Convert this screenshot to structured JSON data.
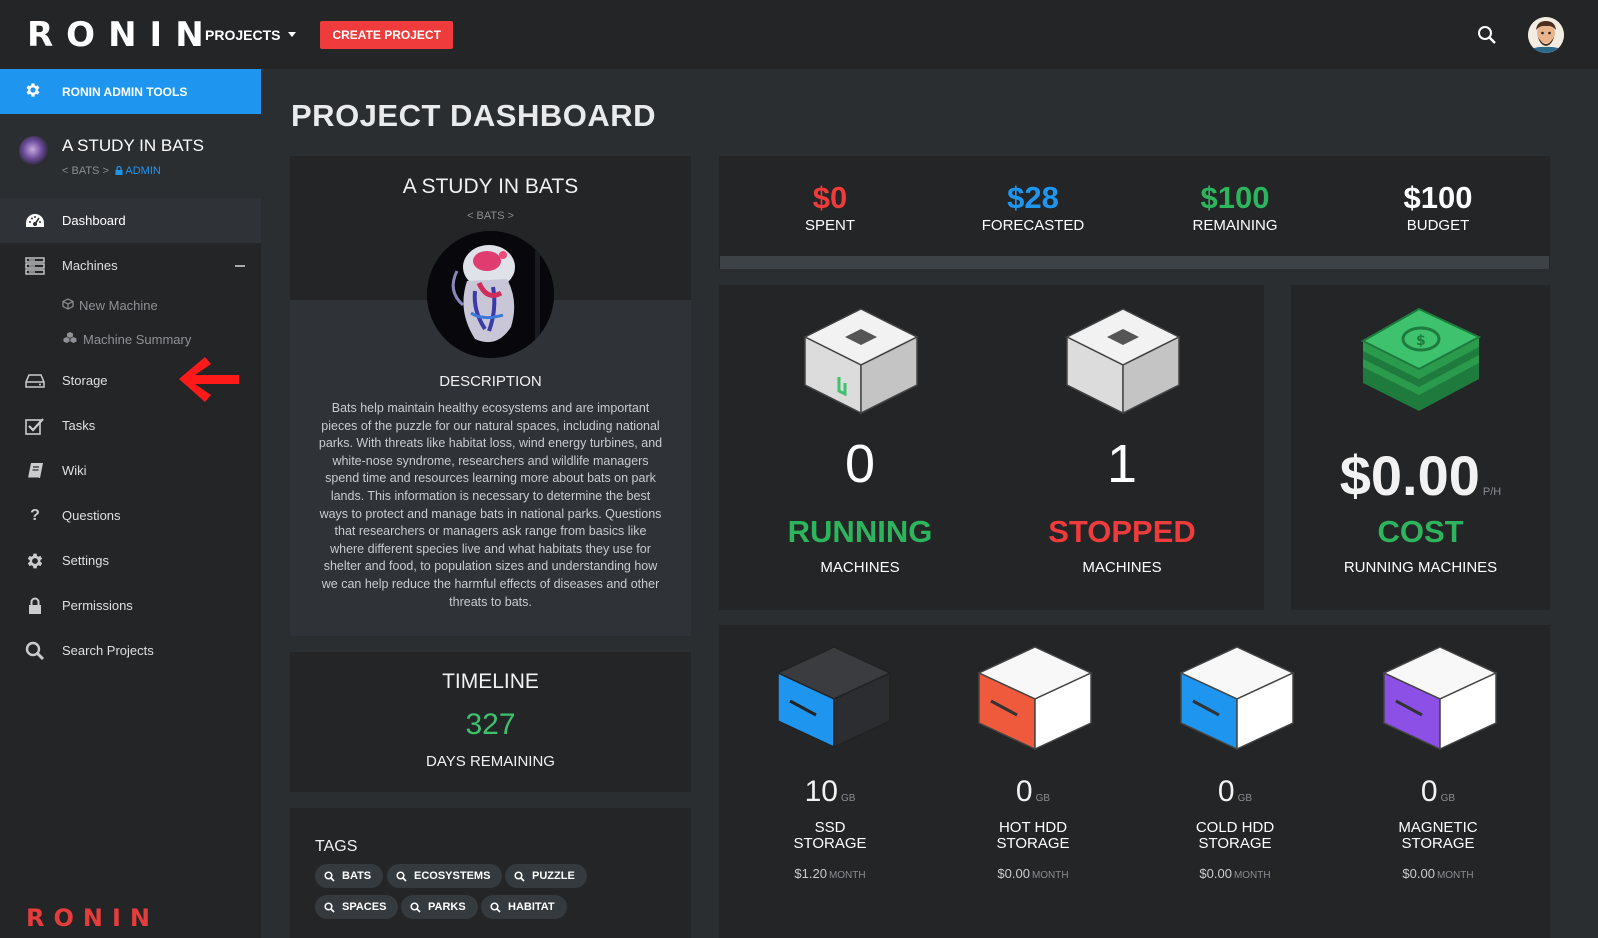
{
  "topbar": {
    "logo": "RONIN",
    "projects_label": "PROJECTS",
    "create_label": "CREATE PROJECT"
  },
  "sidebar": {
    "admin_tools": "RONIN ADMIN TOOLS",
    "project_title": "A STUDY IN BATS",
    "project_slug": "< BATS >",
    "project_role": "ADMIN",
    "items": [
      {
        "label": "Dashboard",
        "icon": "dashboard-icon"
      },
      {
        "label": "Machines",
        "icon": "server-icon"
      },
      {
        "label": "Storage",
        "icon": "hard-drive-icon"
      },
      {
        "label": "Tasks",
        "icon": "checkbox-icon"
      },
      {
        "label": "Wiki",
        "icon": "book-icon"
      },
      {
        "label": "Questions",
        "icon": "question-icon"
      },
      {
        "label": "Settings",
        "icon": "gear-icon"
      },
      {
        "label": "Permissions",
        "icon": "lock-icon"
      },
      {
        "label": "Search Projects",
        "icon": "search-icon"
      }
    ],
    "sub_items": [
      {
        "label": "New Machine",
        "icon": "cube-icon"
      },
      {
        "label": "Machine Summary",
        "icon": "cubes-icon"
      }
    ],
    "footer_logo": "RONIN"
  },
  "main": {
    "page_title": "PROJECT DASHBOARD",
    "project": {
      "title": "A STUDY IN BATS",
      "slug": "< BATS >",
      "description_heading": "DESCRIPTION",
      "description": "Bats help maintain healthy ecosystems and are important pieces of the puzzle for our natural spaces, including national parks. With threats like habitat loss, wind energy turbines, and white-nose syndrome, researchers and wildlife managers spend time and resources learning more about bats on park lands. This information is necessary to determine the best ways to protect and manage bats in national parks. Questions that researchers or managers ask range from basics like where different species live and what habitats they use for shelter and food, to population sizes and understanding how we can help reduce the harmful effects of diseases and other threats to bats."
    },
    "timeline": {
      "title": "TIMELINE",
      "days": "327",
      "label": "DAYS REMAINING"
    },
    "tags": {
      "title": "TAGS",
      "items": [
        "BATS",
        "ECOSYSTEMS",
        "PUZZLE",
        "SPACES",
        "PARKS",
        "HABITAT"
      ]
    },
    "budget": {
      "spent": {
        "value": "$0",
        "label": "SPENT",
        "color": "#ef3b3b"
      },
      "forecasted": {
        "value": "$28",
        "label": "FORECASTED",
        "color": "#1e96f0"
      },
      "remaining": {
        "value": "$100",
        "label": "REMAINING",
        "color": "#2db55d"
      },
      "budget": {
        "value": "$100",
        "label": "BUDGET",
        "color": "#ffffff"
      }
    },
    "machines": {
      "running": {
        "count": "0",
        "state": "RUNNING",
        "label": "MACHINES",
        "color": "#2db55d"
      },
      "stopped": {
        "count": "1",
        "state": "STOPPED",
        "label": "MACHINES",
        "color": "#ef3b3b"
      }
    },
    "cost": {
      "value": "$0.00",
      "unit": "P/H",
      "state": "COST",
      "label": "RUNNING MACHINES",
      "color": "#2db55d"
    },
    "storage": [
      {
        "amount": "10",
        "unit": "GB",
        "line1": "SSD",
        "line2": "STORAGE",
        "price": "$1.20",
        "period": "MONTH",
        "color": "#1e96f0"
      },
      {
        "amount": "0",
        "unit": "GB",
        "line1": "HOT HDD",
        "line2": "STORAGE",
        "price": "$0.00",
        "period": "MONTH",
        "color": "#f05a3c"
      },
      {
        "amount": "0",
        "unit": "GB",
        "line1": "COLD HDD",
        "line2": "STORAGE",
        "price": "$0.00",
        "period": "MONTH",
        "color": "#1e96f0"
      },
      {
        "amount": "0",
        "unit": "GB",
        "line1": "MAGNETIC",
        "line2": "STORAGE",
        "price": "$0.00",
        "period": "MONTH",
        "color": "#8c50e6"
      }
    ]
  }
}
